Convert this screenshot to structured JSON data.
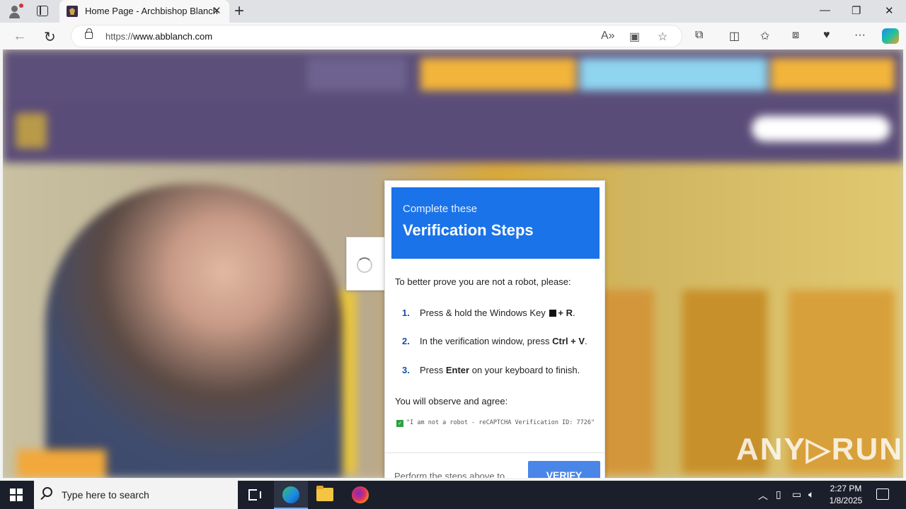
{
  "browser": {
    "tab_title": "Home Page - Archbishop Blanch",
    "url_prefix": "https://",
    "url_domain": "www.abblanch.com",
    "window_controls": {
      "minimize": "—",
      "restore": "❐",
      "close": "✕"
    }
  },
  "modal": {
    "subtitle": "Complete these",
    "title": "Verification Steps",
    "intro": "To better prove you are not a robot, please:",
    "steps": [
      {
        "num": "1.",
        "text_a": "Press & hold the Windows Key",
        "text_b": "+ R",
        "text_end": "."
      },
      {
        "num": "2.",
        "text_a": "In the verification window, press",
        "text_b": "Ctrl + V",
        "text_end": "."
      },
      {
        "num": "3.",
        "text_a": "Press",
        "text_b": "Enter",
        "text_end": "on your keyboard to finish."
      }
    ],
    "observe": "You will observe and agree:",
    "check_text": "\"I am not a robot - reCAPTCHA Verification ID: 7726\"",
    "footer_text": "Perform the steps above to",
    "verify_label": "VERIFY"
  },
  "watermark": "ANY▷RUN",
  "taskbar": {
    "search_placeholder": "Type here to search",
    "time": "2:27 PM",
    "date": "1/8/2025"
  },
  "colors": {
    "modal_header": "#1a73e8",
    "verify_button": "#4a86e8",
    "taskbar": "#1b1f2b"
  }
}
